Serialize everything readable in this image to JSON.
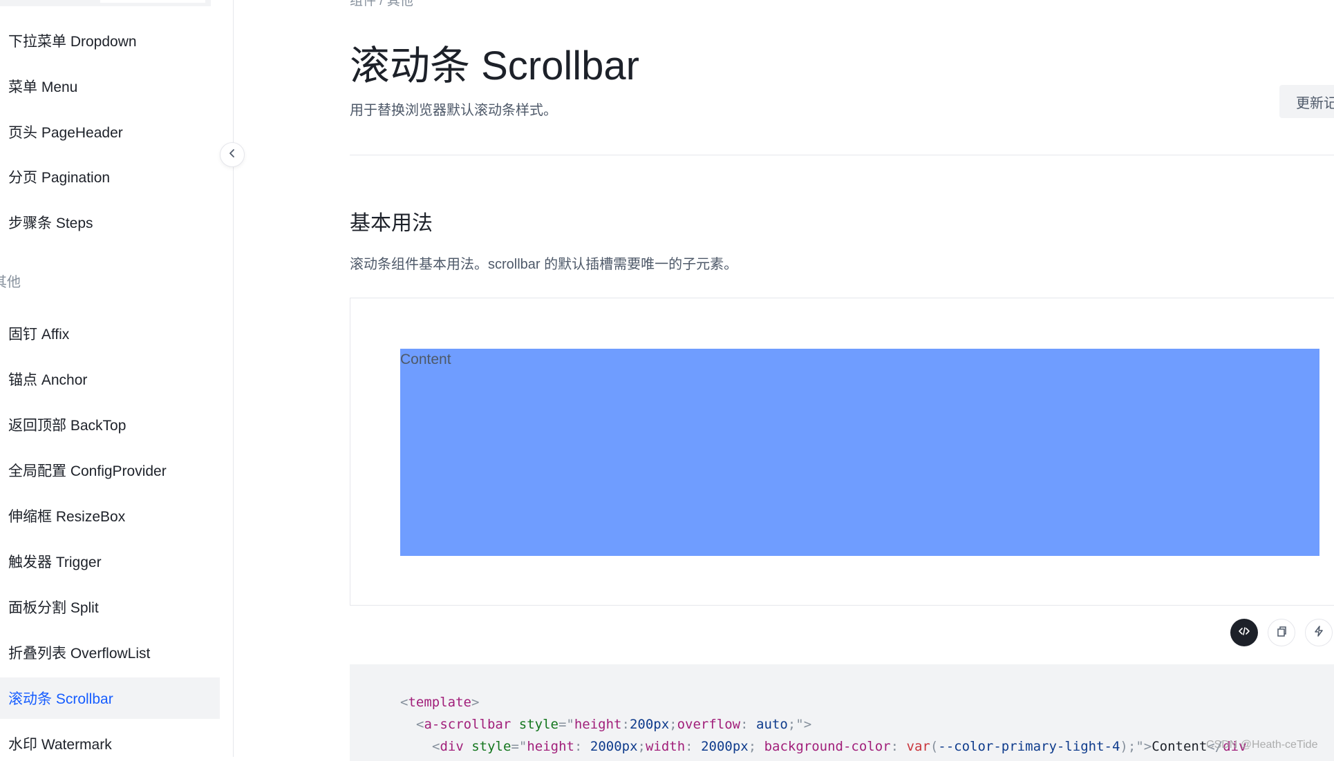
{
  "sidebar": {
    "items": [
      {
        "label": "下拉菜单 Dropdown"
      },
      {
        "label": "菜单 Menu"
      },
      {
        "label": "页头 PageHeader"
      },
      {
        "label": "分页 Pagination"
      },
      {
        "label": "步骤条 Steps"
      },
      {
        "label": "固钉 Affix"
      },
      {
        "label": "锚点 Anchor"
      },
      {
        "label": "返回顶部 BackTop"
      },
      {
        "label": "全局配置 ConfigProvider"
      },
      {
        "label": "伸缩框 ResizeBox"
      },
      {
        "label": "触发器 Trigger"
      },
      {
        "label": "面板分割 Split"
      },
      {
        "label": "折叠列表 OverflowList"
      },
      {
        "label": "滚动条 Scrollbar",
        "active": true
      },
      {
        "label": "水印 Watermark"
      }
    ],
    "group_label": "其他",
    "collapse_icon": "chevron-left-icon"
  },
  "breadcrumb": {
    "text": "组件 / 其他"
  },
  "page": {
    "title": "滚动条 Scrollbar",
    "description": "用于替换浏览器默认滚动条样式。",
    "changelog_label": "更新记录"
  },
  "section": {
    "title": "基本用法",
    "description": "滚动条组件基本用法。scrollbar 的默认插槽需要唯一的子元素。"
  },
  "demo": {
    "content_label": "Content",
    "background_color": "#6f9dff"
  },
  "toolbar": {
    "code_icon": "code-icon",
    "copy_icon": "copy-icon",
    "codepen_icon": "lightning-icon"
  },
  "code": {
    "line1": {
      "lt": "<",
      "tag": "template",
      "gt": ">"
    },
    "line2": {
      "lt": "<",
      "tag": "a-scrollbar",
      "attr": "style",
      "eq": "=",
      "str_open": "\"",
      "prop1": "height",
      "colon1": ":",
      "val1": "200px",
      "semi1": ";",
      "prop2": "overflow",
      "colon2": ": ",
      "val2": "auto",
      "semi2": ";",
      "str_close": "\"",
      "gt": ">"
    },
    "line3": {
      "lt": "<",
      "tag": "div",
      "attr": "style",
      "eq": "=",
      "str_open": "\"",
      "prop1": "height",
      "colon1": ": ",
      "val1": "2000px",
      "semi1": ";",
      "prop2": "width",
      "colon2": ": ",
      "val2": "2000px",
      "semi2": "; ",
      "prop3": "background-color",
      "colon3": ": ",
      "func": "var",
      "paren_open": "(",
      "var": "--color-primary-light-4",
      "paren_close": ")",
      "semi3": ";",
      "str_close": "\"",
      "gt": ">",
      "text": "Content",
      "close_lt": "</",
      "close_tag": "div"
    }
  },
  "watermark": {
    "text": "CSDN @Heath-ceTide"
  }
}
